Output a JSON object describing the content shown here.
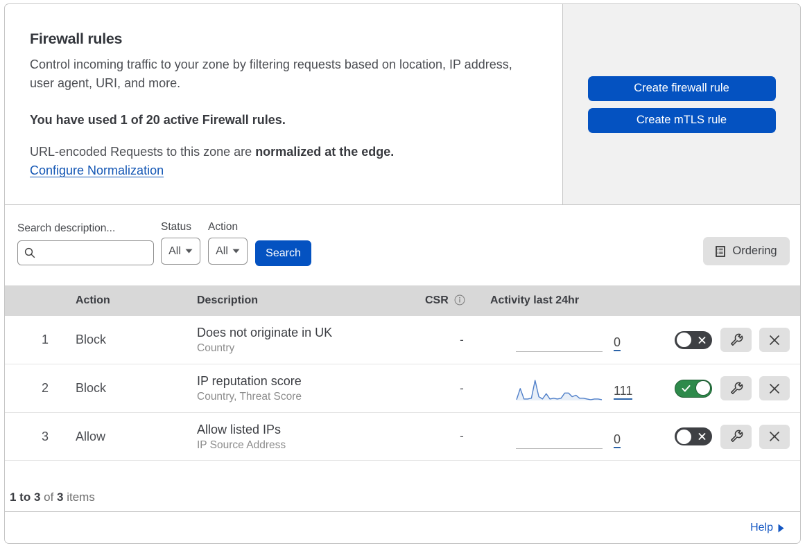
{
  "intro": {
    "title": "Firewall rules",
    "description_line1": "Control incoming traffic to your zone by filtering requests based on location, IP address,",
    "description_line2": "user agent, URI, and more.",
    "usage_note": "You have used 1 of 20 active Firewall rules.",
    "normalization_prefix": "URL-encoded Requests to this zone are ",
    "normalization_bold": "normalized at the edge.",
    "configure_link": "Configure Normalization"
  },
  "actions_panel": {
    "create_firewall_rule": "Create firewall rule",
    "create_mtls_rule": "Create mTLS rule"
  },
  "filters": {
    "search_label": "Search description...",
    "search_placeholder": "",
    "status_label": "Status",
    "status_value": "All",
    "action_label": "Action",
    "action_value": "All",
    "search_button": "Search",
    "ordering_button": "Ordering"
  },
  "table": {
    "headers": {
      "action": "Action",
      "description": "Description",
      "csr": "CSR",
      "activity": "Activity last 24hr"
    },
    "rows": [
      {
        "num": "1",
        "action": "Block",
        "description": "Does not originate in UK",
        "subtitle": "Country",
        "csr": "-",
        "count": "0",
        "enabled": false
      },
      {
        "num": "2",
        "action": "Block",
        "description": "IP reputation score",
        "subtitle": "Country, Threat Score",
        "csr": "-",
        "count": "111",
        "enabled": true
      },
      {
        "num": "3",
        "action": "Allow",
        "description": "Allow listed IPs",
        "subtitle": "IP Source Address",
        "csr": "-",
        "count": "0",
        "enabled": false
      }
    ]
  },
  "chart_data": {
    "type": "area",
    "title": "Activity last 24hr (rule 2 sparkline)",
    "x": [
      0,
      1,
      2,
      3,
      4,
      5,
      6,
      7,
      8,
      9,
      10,
      11,
      12,
      13,
      14,
      15,
      16,
      17,
      18,
      19,
      20,
      21,
      22,
      23
    ],
    "values": [
      1,
      16,
      2,
      2,
      3,
      27,
      5,
      2,
      9,
      2,
      3,
      2,
      3,
      10,
      10,
      5,
      7,
      3,
      3,
      2,
      1,
      2,
      2,
      1
    ],
    "ylim": [
      0,
      27
    ],
    "line_color": "#4f7fc9",
    "fill_color": "rgba(91,139,208,0.14)"
  },
  "footer": {
    "range_bold": "1 to 3",
    "of_text": " of ",
    "total_bold": "3",
    "items_text": " items",
    "help": "Help"
  },
  "colors": {
    "primary_blue": "#0452c1",
    "link_blue": "#1356b4",
    "toggle_on_green": "#2e8a4b",
    "toggle_off_dark": "#3e4044",
    "header_gray": "#d8d8d8",
    "panel_gray": "#f1f1f1",
    "border_gray": "#c6c6c6"
  }
}
